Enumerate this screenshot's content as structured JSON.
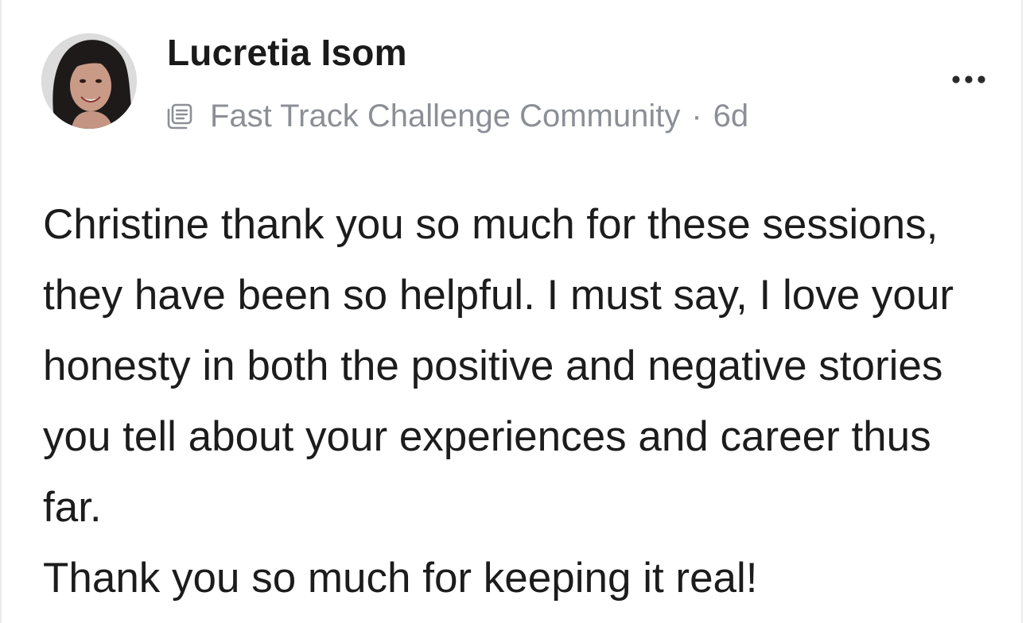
{
  "post": {
    "author": {
      "name": "Lucretia Isom",
      "avatar_icon": "user-avatar-photo"
    },
    "meta": {
      "community_icon": "document-lines-icon",
      "community": "Fast Track Challenge Community",
      "separator": "·",
      "time_ago": "6d"
    },
    "more_icon": "more-horizontal-icon",
    "body": {
      "paragraph_1": "Christine thank you so much for these sessions, they have been so helpful. I must say, I love your honesty in both the positive and negative stories you tell about your experiences and career thus far.",
      "paragraph_2": "Thank you so much for keeping it real!"
    }
  },
  "colors": {
    "text_primary": "#1c1c1c",
    "text_secondary": "#8c8f96",
    "background": "#ffffff",
    "border": "#ebebeb"
  }
}
